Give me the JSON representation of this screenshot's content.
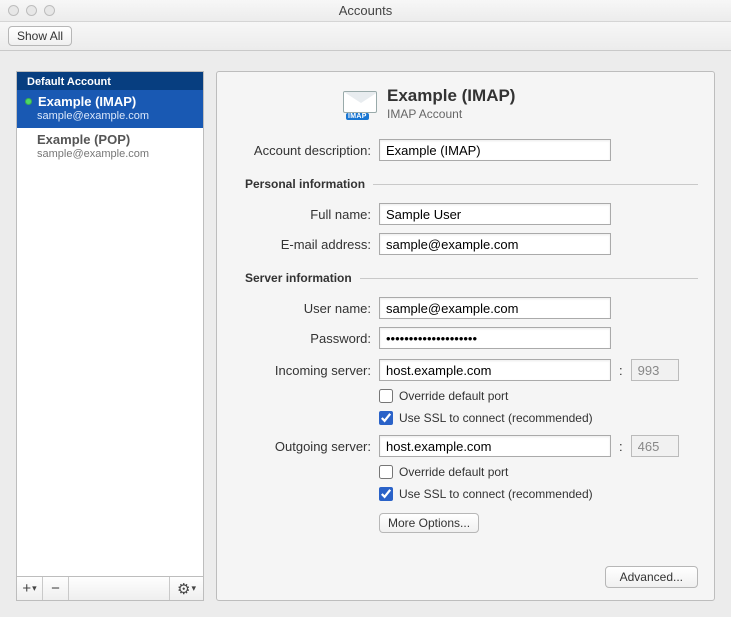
{
  "window": {
    "title": "Accounts"
  },
  "toolbar": {
    "show_all": "Show All"
  },
  "sidebar": {
    "default_header": "Default Account",
    "accounts": [
      {
        "name": "Example (IMAP)",
        "email": "sample@example.com",
        "selected": true,
        "online": true
      },
      {
        "name": "Example (POP)",
        "email": "sample@example.com",
        "selected": false,
        "online": false
      }
    ],
    "buttons": {
      "add": "+",
      "remove": "−",
      "options": "⚙"
    }
  },
  "detail": {
    "icon_badge": "IMAP",
    "title": "Example (IMAP)",
    "subtitle": "IMAP Account",
    "labels": {
      "description": "Account description:",
      "personal_header": "Personal information",
      "full_name": "Full name:",
      "email": "E-mail address:",
      "server_header": "Server information",
      "user_name": "User name:",
      "password": "Password:",
      "incoming": "Incoming server:",
      "outgoing": "Outgoing server:",
      "override": "Override default port",
      "use_ssl": "Use SSL to connect (recommended)",
      "more_options": "More Options...",
      "advanced": "Advanced..."
    },
    "values": {
      "description": "Example (IMAP)",
      "full_name": "Sample User",
      "email": "sample@example.com",
      "user_name": "sample@example.com",
      "password": "••••••••••••••••••••",
      "incoming_server": "host.example.com",
      "incoming_port": "993",
      "incoming_override": false,
      "incoming_ssl": true,
      "outgoing_server": "host.example.com",
      "outgoing_port": "465",
      "outgoing_override": false,
      "outgoing_ssl": true
    }
  }
}
